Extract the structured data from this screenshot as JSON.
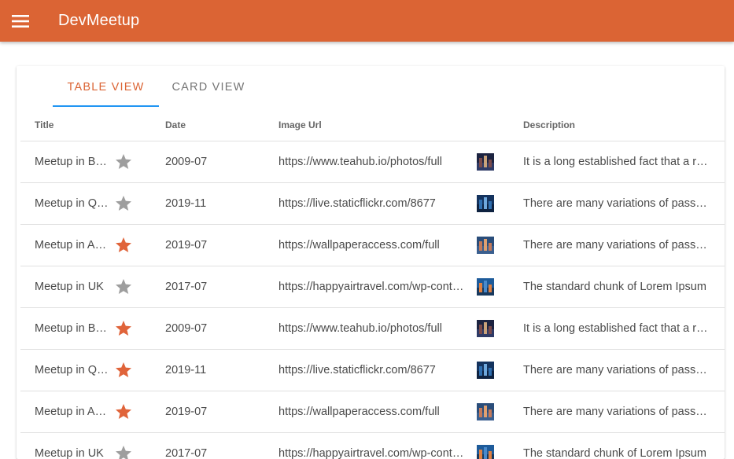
{
  "app": {
    "title": "DevMeetup"
  },
  "tabs": [
    {
      "label": "TABLE VIEW",
      "active": true
    },
    {
      "label": "CARD VIEW",
      "active": false
    }
  ],
  "table": {
    "headers": [
      "Title",
      "Date",
      "Image Url",
      "Description"
    ],
    "rows": [
      {
        "title": "Meetup in Berlin",
        "starred": false,
        "date": "2009-07",
        "image_url": "https://www.teahub.io/photos/full",
        "description": "It is a long established fact that a reader",
        "thumb": "city-night"
      },
      {
        "title": "Meetup in Qatar",
        "starred": false,
        "date": "2019-11",
        "image_url": "https://live.staticflickr.com/8677",
        "description": "There are many variations of passages",
        "thumb": "city-blue"
      },
      {
        "title": "Meetup in Abu Dhabi",
        "starred": true,
        "date": "2019-07",
        "image_url": "https://wallpaperaccess.com/full",
        "description": "There are many variations of passages",
        "thumb": "city-sunset"
      },
      {
        "title": "Meetup in UK",
        "starred": false,
        "date": "2017-07",
        "image_url": "https://happyairtravel.com/wp-content",
        "description": "The standard chunk of Lorem Ipsum",
        "thumb": "city-bridge"
      },
      {
        "title": "Meetup in Berlin",
        "starred": true,
        "date": "2009-07",
        "image_url": "https://www.teahub.io/photos/full",
        "description": "It is a long established fact that a reader",
        "thumb": "city-night"
      },
      {
        "title": "Meetup in Qatar",
        "starred": true,
        "date": "2019-11",
        "image_url": "https://live.staticflickr.com/8677",
        "description": "There are many variations of passages",
        "thumb": "city-blue"
      },
      {
        "title": "Meetup in Abu Dhabi",
        "starred": true,
        "date": "2019-07",
        "image_url": "https://wallpaperaccess.com/full",
        "description": "There are many variations of passages",
        "thumb": "city-sunset"
      },
      {
        "title": "Meetup in UK",
        "starred": false,
        "date": "2017-07",
        "image_url": "https://happyairtravel.com/wp-content",
        "description": "The standard chunk of Lorem Ipsum",
        "thumb": "city-bridge"
      }
    ]
  },
  "colors": {
    "primary": "#db6434",
    "star_on": "#e0643a",
    "star_off": "#9e9e9e",
    "tab_indicator": "#2196f3"
  }
}
